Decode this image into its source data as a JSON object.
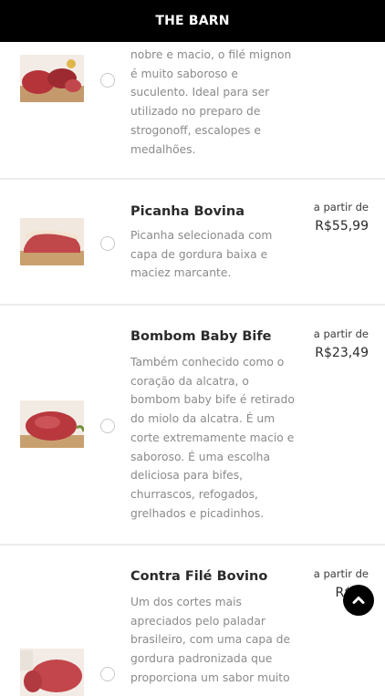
{
  "header": {
    "brand": "THE BARN"
  },
  "products": [
    {
      "name": "",
      "description": "nobre e macio, o filé mignon\né muito saboroso e\nsuculento. Ideal para ser\nutilizado no preparo de\nstrogonoff, escalopes e\nmedalhões.",
      "price_prefix": "",
      "price": "",
      "selected": false,
      "image_icon": "raw-meat-icon"
    },
    {
      "name": "Picanha Bovina",
      "description": "Picanha selecionada com\ncapa de gordura baixa e\nmaciez marcante.",
      "price_prefix": "a partir de",
      "price": "R$55,99",
      "selected": false,
      "image_icon": "raw-meat-icon"
    },
    {
      "name": "Bombom Baby Bife",
      "description": "Também conhecido como o\ncoração da alcatra, o\nbombom baby bife é retirado\ndo miolo da alcatra. É um\ncorte extremamente macio e\nsaboroso. É uma escolha\ndeliciosa para bifes,\nchurrascos, refogados,\ngrelhados e picadinhos.",
      "price_prefix": "a partir de",
      "price": "R$23,49",
      "selected": false,
      "image_icon": "raw-meat-icon"
    },
    {
      "name": "Contra Filé Bovino",
      "description": "Um dos cortes mais\napreciados pelo paladar\nbrasileiro, com uma capa de\ngordura padronizada que\nproporciona um sabor muito",
      "price_prefix": "a partir de",
      "price": "R$18",
      "selected": false,
      "image_icon": "raw-meat-icon"
    }
  ],
  "scroll_top": {
    "icon": "chevron-up-icon"
  },
  "colors": {
    "header_bg": "#000000",
    "header_text": "#ffffff",
    "description_text": "#8a8a8a",
    "divider": "#ececec"
  }
}
